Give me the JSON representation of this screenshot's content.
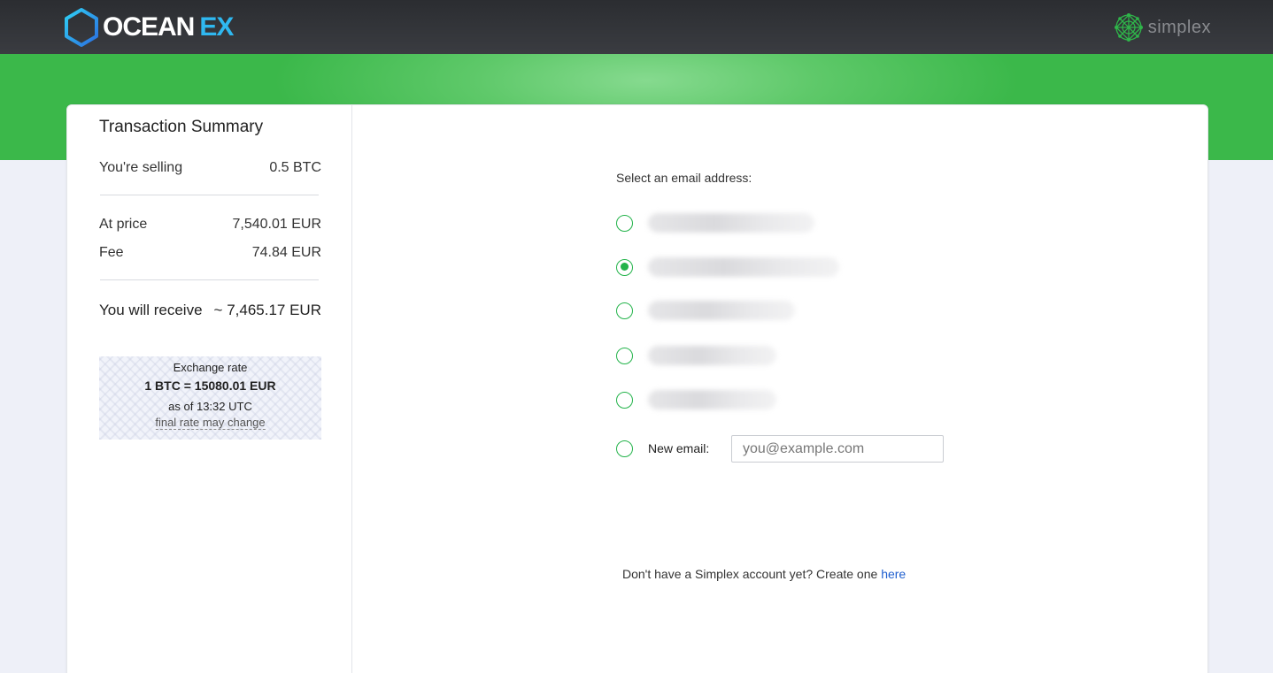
{
  "header": {
    "brand": {
      "prefix": "OCEAN",
      "suffix": "EX"
    },
    "partner": {
      "name": "simplex"
    }
  },
  "colors": {
    "accent_green": "#23b34a",
    "link_blue": "#1f5fcf",
    "brand_blue": "#2fb8f0"
  },
  "summary": {
    "title": "Transaction Summary",
    "selling_label": "You're selling",
    "selling_value": "0.5 BTC",
    "price_label": "At price",
    "price_value": "7,540.01 EUR",
    "fee_label": "Fee",
    "fee_value": "74.84 EUR",
    "receive_label": "You will receive",
    "receive_value": "~ 7,465.17 EUR",
    "rate": {
      "label": "Exchange rate",
      "value": "1 BTC = 15080.01 EUR",
      "time": "as of 13:32 UTC",
      "note": "final rate may change"
    }
  },
  "email_form": {
    "label": "Select an email address:",
    "options": [
      {
        "redacted": true,
        "selected": false
      },
      {
        "redacted": true,
        "selected": true
      },
      {
        "redacted": true,
        "selected": false
      },
      {
        "redacted": true,
        "selected": false
      },
      {
        "redacted": true,
        "selected": false
      }
    ],
    "new_email_label": "New email:",
    "new_email_placeholder": "you@example.com",
    "new_email_value": ""
  },
  "signup": {
    "text": "Don't have a Simplex account yet? Create one ",
    "link": "here"
  },
  "icons": [
    "oceanex-hexagon-logo",
    "simplex-network-logo"
  ]
}
